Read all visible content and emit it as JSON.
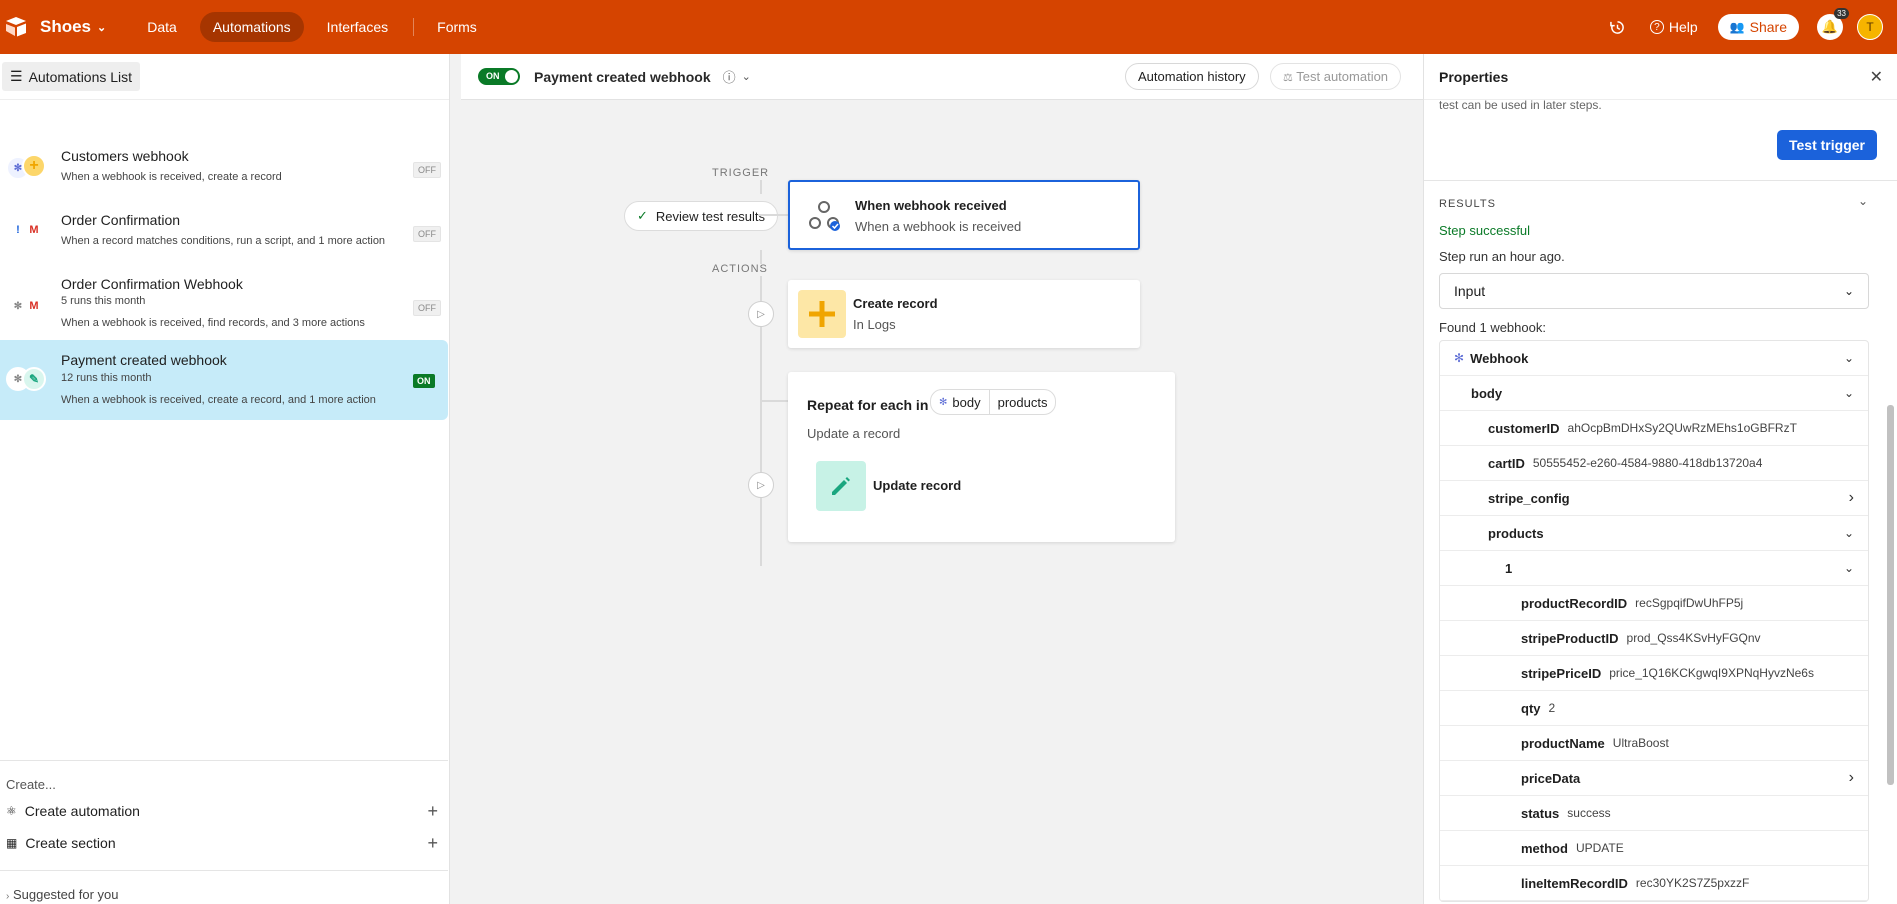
{
  "topbar": {
    "base_name": "Shoes",
    "nav": [
      "Data",
      "Automations",
      "Interfaces",
      "Forms"
    ],
    "help": "Help",
    "share": "Share",
    "notif_count": "33",
    "avatar": "T",
    "brand_color": "#d54400"
  },
  "sidebar": {
    "list_button": "Automations List",
    "items": [
      {
        "title": "Customers webhook",
        "sub1": "When a webhook is received, create a record",
        "sub2": "",
        "state": "OFF"
      },
      {
        "title": "Order Confirmation",
        "sub1": "When a record matches conditions, run a script, and 1 more action",
        "sub2": "",
        "state": "OFF"
      },
      {
        "title": "Order Confirmation Webhook",
        "sub1": "5 runs this month",
        "sub2": "When a webhook is received, find records, and 3 more actions",
        "state": "OFF"
      },
      {
        "title": "Payment created webhook",
        "sub1": "12 runs this month",
        "sub2": "When a webhook is received, create a record, and 1 more action",
        "state": "ON"
      }
    ],
    "create_label": "Create...",
    "create_automation": "Create automation",
    "create_section": "Create section",
    "suggested": "Suggested for you"
  },
  "canvas": {
    "toggle_label": "ON",
    "automation_name": "Payment created webhook",
    "history_button": "Automation history",
    "test_button": "Test automation",
    "trigger_label": "TRIGGER",
    "actions_label": "ACTIONS",
    "review_button": "Review test results",
    "trigger_title": "When webhook received",
    "trigger_sub": "When a webhook is received",
    "create_title": "Create record",
    "create_sub": "In Logs",
    "repeat_label": "Repeat for each in",
    "repeat_pill_a": "body",
    "repeat_pill_b": "products",
    "repeat_sub": "Update a record",
    "update_title": "Update record"
  },
  "panel": {
    "title": "Properties",
    "note": "test can be used in later steps.",
    "test_trigger": "Test trigger",
    "results": "RESULTS",
    "step_status": "Step successful",
    "step_run": "Step run an hour ago.",
    "input_select": "Input",
    "found": "Found 1 webhook:",
    "tree": [
      {
        "key": "Webhook",
        "value": "",
        "indent": 0,
        "chev": "down"
      },
      {
        "key": "body",
        "value": "",
        "indent": 1,
        "chev": "down"
      },
      {
        "key": "customerID",
        "value": "ahOcpBmDHxSy2QUwRzMEhs1oGBFRzT",
        "indent": 2,
        "chev": ""
      },
      {
        "key": "cartID",
        "value": "50555452-e260-4584-9880-418db13720a4",
        "indent": 2,
        "chev": ""
      },
      {
        "key": "stripe_config",
        "value": "",
        "indent": 2,
        "chev": "right"
      },
      {
        "key": "products",
        "value": "",
        "indent": 2,
        "chev": "down"
      },
      {
        "key": "1",
        "value": "",
        "indent": 3,
        "chev": "down"
      },
      {
        "key": "productRecordID",
        "value": "recSgpqifDwUhFP5j",
        "indent": 4,
        "chev": ""
      },
      {
        "key": "stripeProductID",
        "value": "prod_Qss4KSvHyFGQnv",
        "indent": 4,
        "chev": ""
      },
      {
        "key": "stripePriceID",
        "value": "price_1Q16KCKgwqI9XPNqHyvzNe6s",
        "indent": 4,
        "chev": ""
      },
      {
        "key": "qty",
        "value": "2",
        "indent": 4,
        "chev": ""
      },
      {
        "key": "productName",
        "value": "UltraBoost",
        "indent": 4,
        "chev": ""
      },
      {
        "key": "priceData",
        "value": "",
        "indent": 4,
        "chev": "right"
      },
      {
        "key": "status",
        "value": "success",
        "indent": 4,
        "chev": ""
      },
      {
        "key": "method",
        "value": "UPDATE",
        "indent": 4,
        "chev": ""
      },
      {
        "key": "lineItemRecordID",
        "value": "rec30YK2S7Z5pxzzF",
        "indent": 4,
        "chev": ""
      }
    ]
  }
}
